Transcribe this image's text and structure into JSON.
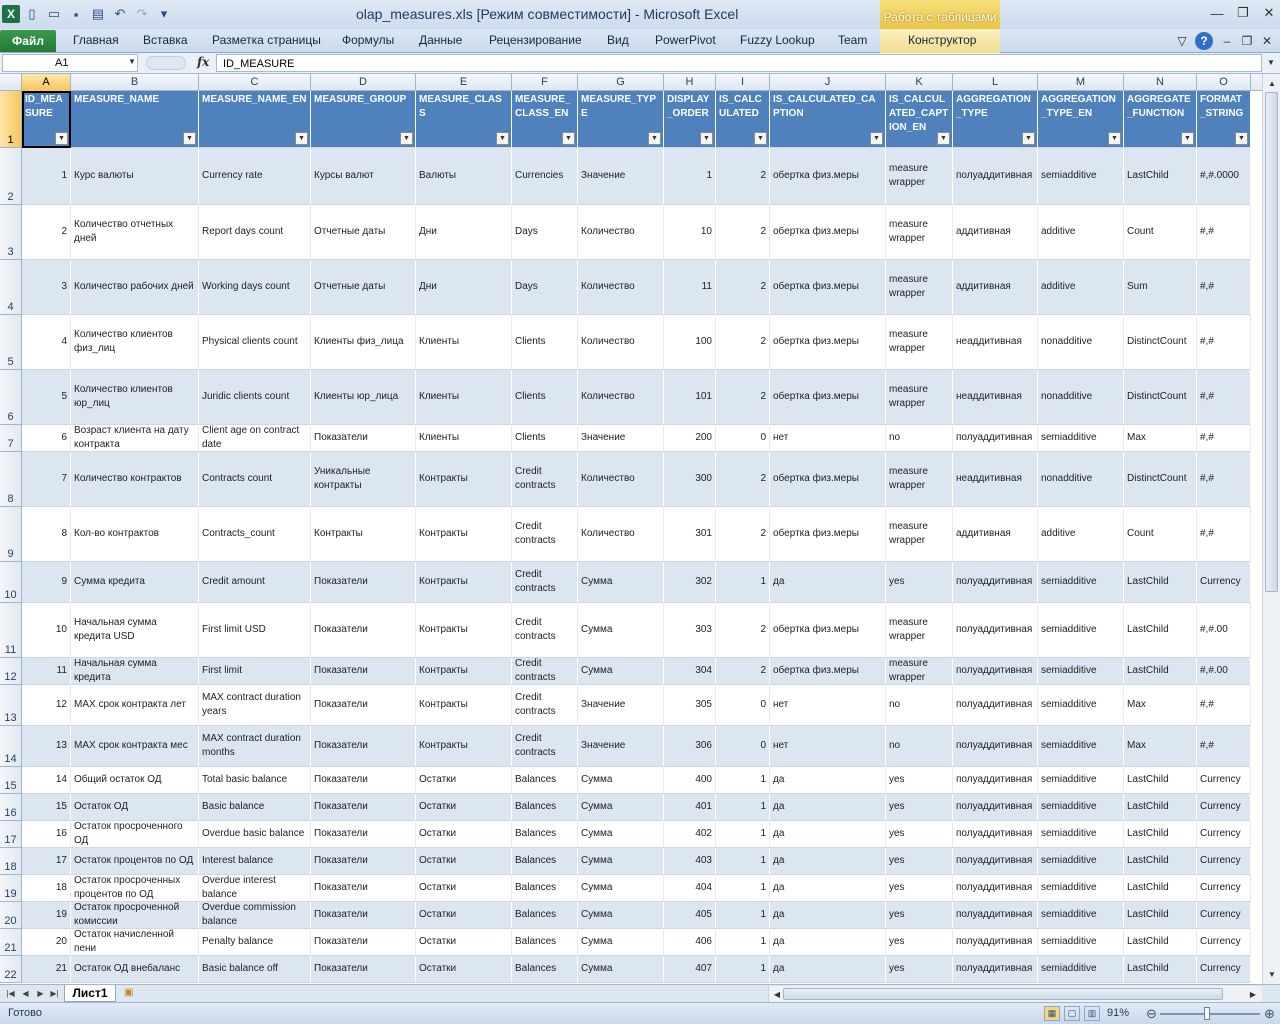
{
  "window": {
    "title": "olap_measures.xls  [Режим совместимости]  -  Microsoft Excel",
    "contextual_group": "Работа с таблицами"
  },
  "ribbon": {
    "file_tab": "Файл",
    "tabs": [
      "Главная",
      "Вставка",
      "Разметка страницы",
      "Формулы",
      "Данные",
      "Рецензирование",
      "Вид",
      "PowerPivot",
      "Fuzzy Lookup",
      "Team",
      "Конструктор"
    ]
  },
  "formula_bar": {
    "name_box": "A1",
    "fx": "fx",
    "content": "ID_MEASURE"
  },
  "columns": [
    "A",
    "B",
    "C",
    "D",
    "E",
    "F",
    "G",
    "H",
    "I",
    "J",
    "K",
    "L",
    "M",
    "N",
    "O"
  ],
  "headers": [
    "ID_MEASURE",
    "MEASURE_NAME",
    "MEASURE_NAME_EN",
    "MEASURE_GROUP",
    "MEASURE_CLASS",
    "MEASURE_CLASS_EN",
    "MEASURE_TYPE",
    "DISPLAY_ORDER",
    "IS_CALCULATED",
    "IS_CALCULATED_CAPTION",
    "IS_CALCULATED_CAPTION_EN",
    "AGGREGATION_TYPE",
    "AGGREGATION_TYPE_EN",
    "AGGREGATE_FUNCTION",
    "FORMAT_STRING"
  ],
  "rows": [
    {
      "n": "2",
      "c": [
        "1",
        "Курс валюты",
        "Currency rate",
        "Курсы валют",
        "Валюты",
        "Currencies",
        "Значение",
        "1",
        "2",
        "обертка физ.меры",
        "measure wrapper",
        "полуаддитивная",
        "semiadditive",
        "LastChild",
        "#,#.0000"
      ]
    },
    {
      "n": "3",
      "c": [
        "2",
        "Количество отчетных дней",
        "Report days count",
        "Отчетные даты",
        "Дни",
        "Days",
        "Количество",
        "10",
        "2",
        "обертка физ.меры",
        "measure wrapper",
        "аддитивная",
        "additive",
        "Count",
        "#,#"
      ]
    },
    {
      "n": "4",
      "c": [
        "3",
        "Количество рабочих дней",
        "Working days count",
        "Отчетные даты",
        "Дни",
        "Days",
        "Количество",
        "11",
        "2",
        "обертка физ.меры",
        "measure wrapper",
        "аддитивная",
        "additive",
        "Sum",
        "#,#"
      ]
    },
    {
      "n": "5",
      "c": [
        "4",
        "Количество клиентов физ_лиц",
        "Physical clients count",
        "Клиенты физ_лица",
        "Клиенты",
        "Clients",
        "Количество",
        "100",
        "2",
        "обертка физ.меры",
        "measure wrapper",
        "неаддитивная",
        "nonadditive",
        "DistinctCount",
        "#,#"
      ]
    },
    {
      "n": "6",
      "c": [
        "5",
        "Количество клиентов юр_лиц",
        "Juridic clients count",
        "Клиенты юр_лица",
        "Клиенты",
        "Clients",
        "Количество",
        "101",
        "2",
        "обертка физ.меры",
        "measure wrapper",
        "неаддитивная",
        "nonadditive",
        "DistinctCount",
        "#,#"
      ]
    },
    {
      "n": "7",
      "c": [
        "6",
        "Возраст клиента на дату контракта",
        "Client age on contract date",
        "Показатели",
        "Клиенты",
        "Clients",
        "Значение",
        "200",
        "0",
        "нет",
        "no",
        "полуаддитивная",
        "semiadditive",
        "Max",
        "#,#"
      ]
    },
    {
      "n": "8",
      "c": [
        "7",
        "Количество контрактов",
        "Contracts count",
        "Уникальные контракты",
        "Контракты",
        "Credit contracts",
        "Количество",
        "300",
        "2",
        "обертка физ.меры",
        "measure wrapper",
        "неаддитивная",
        "nonadditive",
        "DistinctCount",
        "#,#"
      ]
    },
    {
      "n": "9",
      "c": [
        "8",
        "Кол-во контрактов",
        "Contracts_count",
        "Контракты",
        "Контракты",
        "Credit contracts",
        "Количество",
        "301",
        "2",
        "обертка физ.меры",
        "measure wrapper",
        "аддитивная",
        "additive",
        "Count",
        "#,#"
      ]
    },
    {
      "n": "10",
      "c": [
        "9",
        "Сумма кредита",
        "Credit amount",
        "Показатели",
        "Контракты",
        "Credit contracts",
        "Сумма",
        "302",
        "1",
        "да",
        "yes",
        "полуаддитивная",
        "semiadditive",
        "LastChild",
        "Currency"
      ]
    },
    {
      "n": "11",
      "c": [
        "10",
        "Начальная сумма кредита USD",
        "First limit USD",
        "Показатели",
        "Контракты",
        "Credit contracts",
        "Сумма",
        "303",
        "2",
        "обертка физ.меры",
        "measure wrapper",
        "полуаддитивная",
        "semiadditive",
        "LastChild",
        "#,#.00"
      ]
    },
    {
      "n": "12",
      "c": [
        "11",
        "Начальная сумма кредита",
        "First limit",
        "Показатели",
        "Контракты",
        "Credit contracts",
        "Сумма",
        "304",
        "2",
        "обертка физ.меры",
        "measure wrapper",
        "полуаддитивная",
        "semiadditive",
        "LastChild",
        "#,#.00"
      ]
    },
    {
      "n": "13",
      "c": [
        "12",
        "MAX срок контракта лет",
        "MAX contract duration years",
        "Показатели",
        "Контракты",
        "Credit contracts",
        "Значение",
        "305",
        "0",
        "нет",
        "no",
        "полуаддитивная",
        "semiadditive",
        "Max",
        "#,#"
      ]
    },
    {
      "n": "14",
      "c": [
        "13",
        "MAX срок контракта мес",
        "MAX contract duration months",
        "Показатели",
        "Контракты",
        "Credit contracts",
        "Значение",
        "306",
        "0",
        "нет",
        "no",
        "полуаддитивная",
        "semiadditive",
        "Max",
        "#,#"
      ]
    },
    {
      "n": "15",
      "c": [
        "14",
        "Общий остаток ОД",
        "Total basic balance",
        "Показатели",
        "Остатки",
        "Balances",
        "Сумма",
        "400",
        "1",
        "да",
        "yes",
        "полуаддитивная",
        "semiadditive",
        "LastChild",
        "Currency"
      ]
    },
    {
      "n": "16",
      "c": [
        "15",
        "Остаток ОД",
        "Basic balance",
        "Показатели",
        "Остатки",
        "Balances",
        "Сумма",
        "401",
        "1",
        "да",
        "yes",
        "полуаддитивная",
        "semiadditive",
        "LastChild",
        "Currency"
      ]
    },
    {
      "n": "17",
      "c": [
        "16",
        "Остаток просроченного ОД",
        "Overdue basic balance",
        "Показатели",
        "Остатки",
        "Balances",
        "Сумма",
        "402",
        "1",
        "да",
        "yes",
        "полуаддитивная",
        "semiadditive",
        "LastChild",
        "Currency"
      ]
    },
    {
      "n": "18",
      "c": [
        "17",
        "Остаток процентов по ОД",
        "Interest balance",
        "Показатели",
        "Остатки",
        "Balances",
        "Сумма",
        "403",
        "1",
        "да",
        "yes",
        "полуаддитивная",
        "semiadditive",
        "LastChild",
        "Currency"
      ]
    },
    {
      "n": "19",
      "c": [
        "18",
        "Остаток просроченных процентов по ОД",
        "Overdue interest balance",
        "Показатели",
        "Остатки",
        "Balances",
        "Сумма",
        "404",
        "1",
        "да",
        "yes",
        "полуаддитивная",
        "semiadditive",
        "LastChild",
        "Currency"
      ]
    },
    {
      "n": "20",
      "c": [
        "19",
        "Остаток просроченной комиссии",
        "Overdue commission balance",
        "Показатели",
        "Остатки",
        "Balances",
        "Сумма",
        "405",
        "1",
        "да",
        "yes",
        "полуаддитивная",
        "semiadditive",
        "LastChild",
        "Currency"
      ]
    },
    {
      "n": "21",
      "c": [
        "20",
        "Остаток начисленной пени",
        "Penalty balance",
        "Показатели",
        "Остатки",
        "Balances",
        "Сумма",
        "406",
        "1",
        "да",
        "yes",
        "полуаддитивная",
        "semiadditive",
        "LastChild",
        "Currency"
      ]
    },
    {
      "n": "22",
      "c": [
        "21",
        "Остаток ОД внебаланс",
        "Basic balance off",
        "Показатели",
        "Остатки",
        "Balances",
        "Сумма",
        "407",
        "1",
        "да",
        "yes",
        "полуаддитивная",
        "semiadditive",
        "LastChild",
        "Currency"
      ]
    }
  ],
  "header_row_number": "1",
  "sheet": {
    "tab": "Лист1"
  },
  "status": {
    "ready": "Готово",
    "zoom": "91%"
  }
}
